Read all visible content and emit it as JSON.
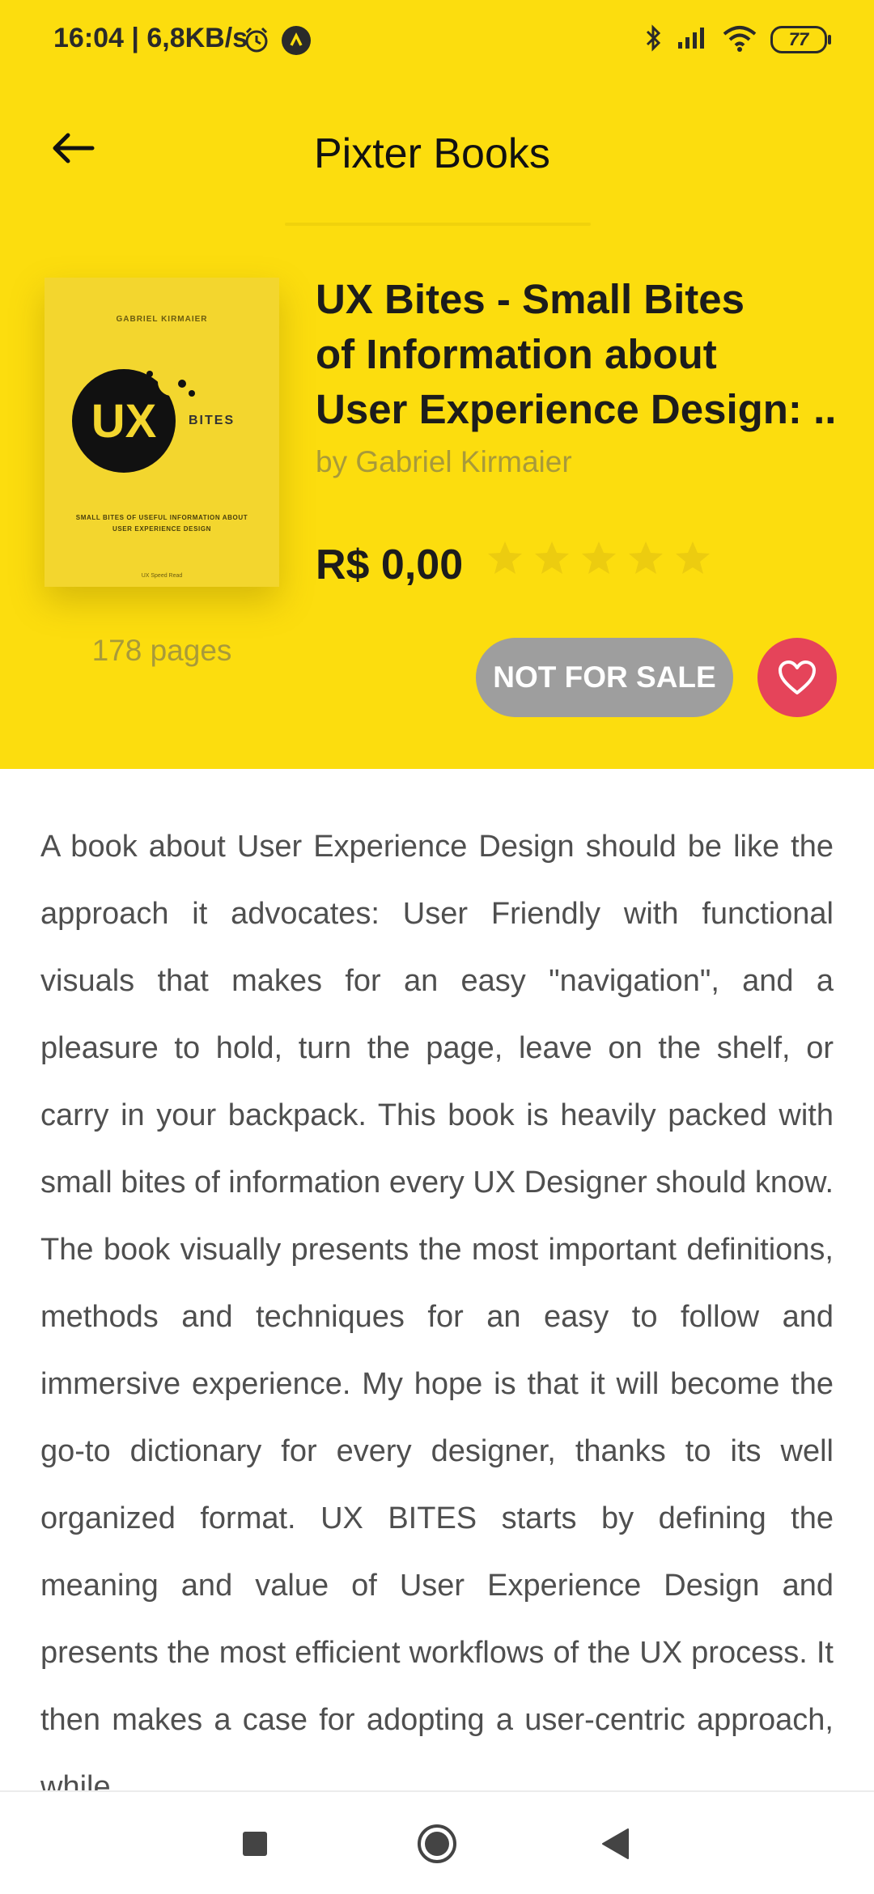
{
  "status_bar": {
    "time": "16:04 | 6,8KB/s",
    "battery": "77"
  },
  "app_bar": {
    "title": "Pixter Books"
  },
  "book": {
    "title_lines": [
      "UX Bites - Small Bites",
      "of Information about",
      "User Experience Design: .."
    ],
    "author": "by Gabriel Kirmaier",
    "price": "R$ 0,00",
    "rating": 0,
    "rating_max": 5,
    "pages": "178 pages",
    "sale_button": "NOT FOR SALE",
    "cover": {
      "author": "GABRIEL KIRMAIER",
      "logo_text": "UX",
      "bites_text": "BITES",
      "subtitle": "SMALL BITES OF USEFUL INFORMATION ABOUT USER EXPERIENCE DESIGN",
      "footer": "UX Speed Read"
    }
  },
  "description": "A book about User Experience Design should be like the approach it advocates: User Friendly with functional visuals that makes for an easy \"navigation\", and a pleasure to hold, turn the page, leave on the shelf, or carry in your backpack. This book is heavily packed with small bites of information every UX Designer should know. The book visually presents the most important definitions, methods and techniques for an easy to follow and immersive experience. My hope is that it will become the go-to dictionary for every designer, thanks to its well organized format. UX BITES starts by defining the meaning and value of User Experience Design and presents the most efficient workflows of the UX process. It then makes a case for adopting a user-centric approach, while",
  "colors": {
    "hero_background": "#fcdd0e",
    "favorite_button": "#e5445a",
    "sale_button": "#9e9e9e"
  },
  "icons": {
    "back": "arrow-left-icon",
    "favorite": "heart-icon",
    "nav_recents": "square-icon",
    "nav_home": "circle-icon",
    "nav_back": "triangle-icon"
  }
}
